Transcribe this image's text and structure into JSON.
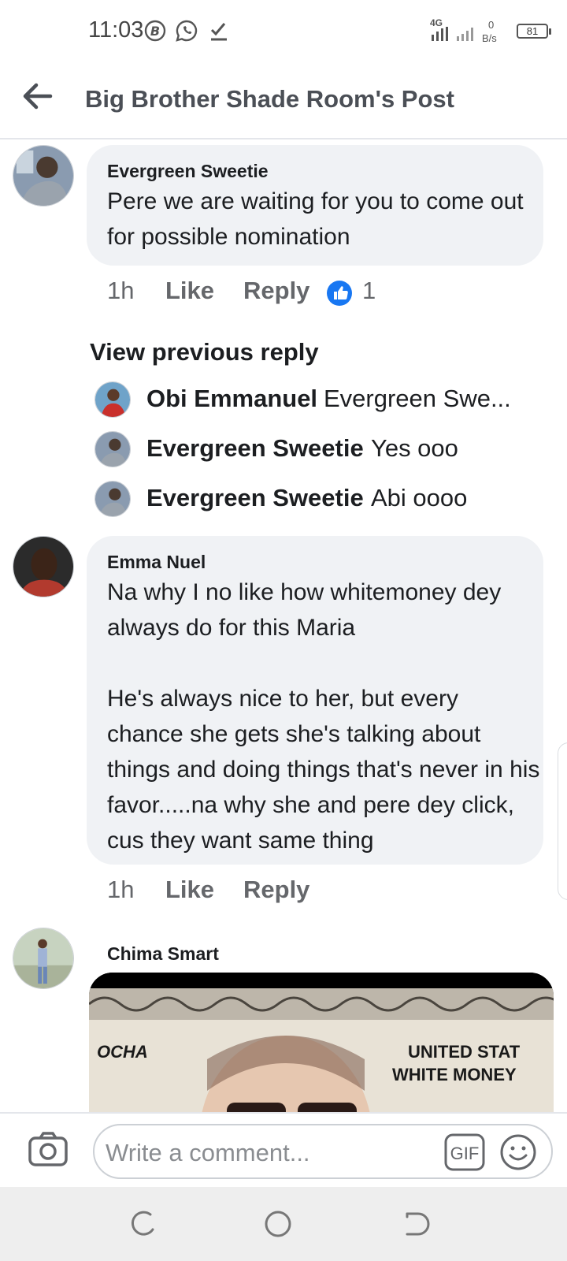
{
  "status_bar": {
    "time": "11:03",
    "network_type": "4G",
    "data_speed_value": "0",
    "data_speed_unit": "B/s",
    "battery": "81"
  },
  "header": {
    "title": "Big Brother Shade Room's Post",
    "back_icon": "arrow-left-icon"
  },
  "comments": [
    {
      "author": "Evergreen Sweetie",
      "text": "Pere we are waiting for you to come out for possible nomination",
      "time": "1h",
      "like_label": "Like",
      "reply_label": "Reply",
      "reaction_count": "1"
    },
    {
      "author": "Emma Nuel",
      "text": "Na why I no like how whitemoney dey always do for this Maria\n\nHe's always nice to her, but every chance she gets she's talking about things and doing things that's never in his favor.....na why she and pere dey click, cus they want same thing",
      "time": "1h",
      "like_label": "Like",
      "reply_label": "Reply"
    },
    {
      "author": "Chima Smart",
      "image_text_left": "OCHA",
      "image_text_right_1": "UNITED STAT",
      "image_text_right_2": "WHITE MONEY"
    }
  ],
  "replies": {
    "view_previous_label": "View previous reply",
    "items": [
      {
        "name": "Obi Emmanuel",
        "text": "Evergreen Swe..."
      },
      {
        "name": "Evergreen Sweetie",
        "text": "Yes ooo"
      },
      {
        "name": "Evergreen Sweetie",
        "text": "Abi oooo"
      }
    ]
  },
  "composer": {
    "placeholder": "Write a comment...",
    "gif_label": "GIF",
    "camera_icon": "camera-icon",
    "emoji_icon": "smiley-icon"
  },
  "colors": {
    "bubble": "#f0f2f5",
    "meta": "#65676b",
    "like_blue": "#1877f2",
    "title": "#4b4f56"
  }
}
